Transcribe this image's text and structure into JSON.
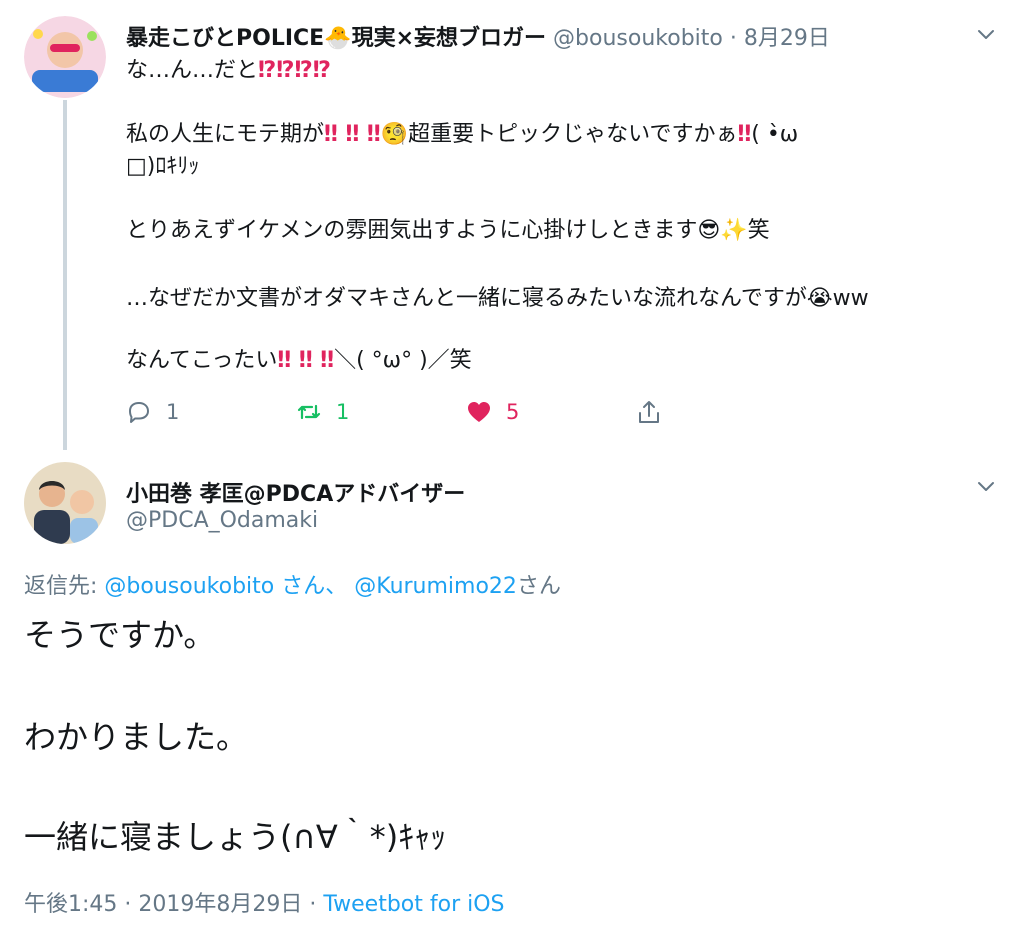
{
  "tweet1": {
    "name": "暴走こびとPOLICE🐣現実×妄想ブロガー",
    "handle": "@bousoukobito",
    "sep": " · ",
    "date": "8月29日",
    "line1": "な…ん…だと",
    "line1_marks": "⁉⁉⁉⁉",
    "line2a": "私の人生にモテ期が",
    "line2_marks": "‼ ‼ ‼",
    "line2b": "🧐超重要トピックじゃないですかぁ",
    "line2c_marks": "‼",
    "line2d": "( •̀ω",
    "line3": "□)ﾛｷﾘｯ",
    "line4": "とりあえずイケメンの雰囲気出すように心掛けしときます😎✨笑",
    "line5": "…なぜだか文書がオダマキさんと一緒に寝るみたいな流れなんですが😭ww",
    "line6a": "なんてこったい",
    "line6_marks": "‼ ‼ ‼",
    "line6b": "＼( °ω° )／笑",
    "reply_count": "1",
    "retweet_count": "1",
    "like_count": "5"
  },
  "tweet2": {
    "name": "小田巻 孝匡@PDCAアドバイザー",
    "handle": "@PDCA_Odamaki",
    "reply_label": "返信先:",
    "reply_to_1": "@bousoukobito さん、",
    "reply_to_2": "@Kurumimo22",
    "reply_suffix": "さん",
    "text1": "そうですか。",
    "text2": "わかりました。",
    "text3": "一緒に寝ましょう(∩∀｀*)ｷｬｯ",
    "time": "午後1:45 · 2019年8月29日",
    "meta_sep": " · ",
    "source": "Tweetbot for iOS"
  },
  "colors": {
    "accent": "#1da1f2",
    "muted": "#657786",
    "like": "#e0245e",
    "retweet": "#17bf63"
  },
  "icons": [
    "reply-icon",
    "retweet-icon",
    "like-icon",
    "share-icon",
    "chevron-down-icon"
  ]
}
